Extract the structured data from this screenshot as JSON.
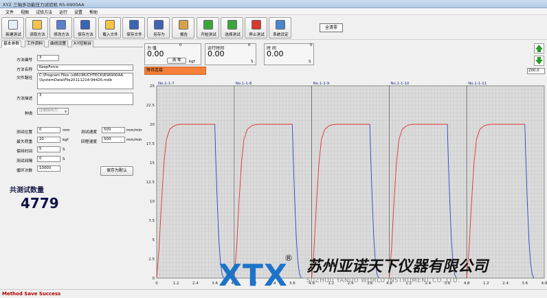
{
  "window": {
    "title": "XYZ 三轴多功能压力试验机 RS-6900AA"
  },
  "menu": [
    "文件",
    "视图",
    "试验方法",
    "运行",
    "设置",
    "帮助"
  ],
  "toolbar": [
    {
      "label": "新建测试",
      "icon": "new-file-icon",
      "color": "#e8eef8"
    },
    {
      "label": "读取方法",
      "icon": "folder-open-icon",
      "color": "#f2c447"
    },
    {
      "label": "修改方法",
      "icon": "edit-icon",
      "color": "#5b7fc9"
    },
    {
      "label": "保存方法",
      "icon": "save-icon",
      "color": "#3c64b0"
    },
    {
      "label": "载入文件",
      "icon": "folder-open-icon",
      "color": "#f2c447"
    },
    {
      "label": "保存文件",
      "icon": "save-icon",
      "color": "#3c64b0"
    },
    {
      "label": "另存为",
      "icon": "save-as-icon",
      "color": "#3c64b0"
    },
    {
      "label": "报告",
      "icon": "report-icon",
      "color": "#d8a24a"
    },
    {
      "label": "开始测试",
      "icon": "play-icon",
      "color": "#3aa63a"
    },
    {
      "label": "选择测试",
      "icon": "select-icon",
      "color": "#3aa63a"
    },
    {
      "label": "停止测试",
      "icon": "stop-icon",
      "color": "#d63a2a"
    },
    {
      "label": "系统设定",
      "icon": "settings-icon",
      "color": "#4a86c8"
    }
  ],
  "clear_all": "全清零",
  "tabs": [
    "基本参数",
    "工作资料",
    "曲线设置",
    "X-Y控制台"
  ],
  "params": {
    "method_no_label": "方法编号",
    "method_no": "3",
    "method_name_label": "方法名称",
    "method_name": "KeepForce",
    "file_path_label": "文件路径",
    "file_path_line1": "C:\\Program Files (x86)\\MUCHTECK\\RS6900AA",
    "file_path_line2": "\\SystemData\\File20111214-94426.mdb",
    "desc_label": "方法描述",
    "desc": "3",
    "type_label": "种类",
    "type_value": "压缩保持力",
    "test_pos_label": "测试位置",
    "test_pos": "0",
    "test_pos_unit": "mm",
    "test_speed_label": "测试速度",
    "test_speed": "500",
    "test_speed_unit": "mm/min",
    "max_load_label": "最大荷重",
    "max_load": "20",
    "max_load_unit": "kgf",
    "return_speed_label": "回程速度",
    "return_speed": "500",
    "return_speed_unit": "mm/min",
    "hold_time_label": "保持时间",
    "hold_time": "5",
    "hold_time_unit": "S",
    "interval_label": "测试间隔",
    "interval": "0",
    "interval_unit": "S",
    "cycles_label": "循环次数",
    "cycles": "10000",
    "save_default": "保存为默认"
  },
  "total": {
    "label": "共测试数量",
    "value": "4779"
  },
  "readouts": [
    {
      "title": "力  值",
      "num": "0",
      "value": "0.00",
      "unit": "kgf",
      "zero": "清 零"
    },
    {
      "title": "运行时间",
      "num": "0",
      "value": "0.00",
      "unit": "S"
    },
    {
      "title": "时  间",
      "num": "0",
      "value": "0.00",
      "unit": "S"
    }
  ],
  "status": "等待连接",
  "zoom": "200.0",
  "status_bar": "Method Save Success",
  "colors": {
    "rise": "#e03030",
    "fall": "#2a40c8",
    "grid": "#b8b8b8",
    "status_orange": "#f5803a",
    "status_text": "#b00000"
  },
  "watermark": {
    "logo": "XTX",
    "company_cn": "苏州亚诺天下仪器有限公司",
    "company_en": "SUZHOU YANUO WORLD INSTRUMENT CO.,LTD."
  },
  "chart_data": {
    "type": "line",
    "panels": [
      "No.1-1-7",
      "No.1-1-8",
      "No.1-1-9",
      "No.1-1-10",
      "No.1-1-11"
    ],
    "ylim": [
      0,
      25
    ],
    "yticks": [
      0,
      2.5,
      5,
      7.5,
      10,
      12.5,
      15,
      17.5,
      20,
      22.5,
      25
    ],
    "xlim": [
      0,
      4.8
    ],
    "xticks": [
      0,
      1.2,
      2.4,
      3.6,
      4.8
    ],
    "grid": true,
    "series": [
      {
        "x": [
          0,
          0.15,
          0.3,
          0.45,
          0.6,
          0.8,
          1.0,
          1.2,
          1.5,
          3.0,
          3.6
        ],
        "values": [
          0,
          4,
          10,
          15,
          18,
          19.3,
          19.7,
          19.9,
          20,
          20,
          20
        ]
      },
      {
        "x": [
          3.6,
          3.65,
          3.75,
          3.85,
          3.95,
          4.05,
          4.15
        ],
        "values": [
          20,
          16,
          10,
          5,
          2,
          0.5,
          0
        ]
      }
    ]
  }
}
